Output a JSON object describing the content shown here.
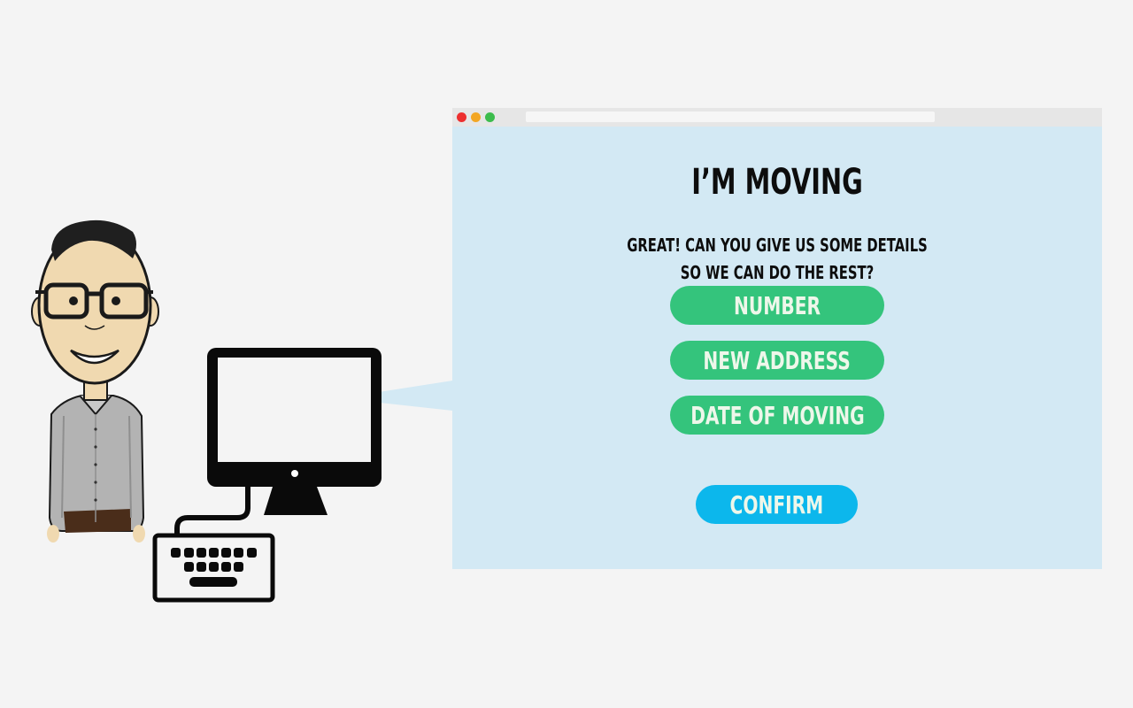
{
  "page": {
    "title": "I’M MOVING",
    "subtitle_line1": "GREAT! CAN YOU GIVE US SOME DETAILS",
    "subtitle_line2": "SO WE CAN DO THE REST?"
  },
  "form": {
    "number_label": "NUMBER",
    "address_label": "NEW ADDRESS",
    "date_label": "DATE OF MOVING",
    "confirm_label": "CONFIRM"
  },
  "colors": {
    "background": "#f4f4f4",
    "browser_content": "#d3e9f4",
    "browser_chrome": "#e6e6e6",
    "pill_green": "#34c47c",
    "confirm_blue": "#0cb7ec",
    "dot_red": "#ed2f2f",
    "dot_orange": "#f3a623",
    "dot_green": "#3cbc4c",
    "pill_text": "#eef7ea"
  },
  "icons": {
    "person": "person-with-glasses-icon",
    "monitor": "desktop-monitor-icon",
    "keyboard": "keyboard-icon"
  }
}
